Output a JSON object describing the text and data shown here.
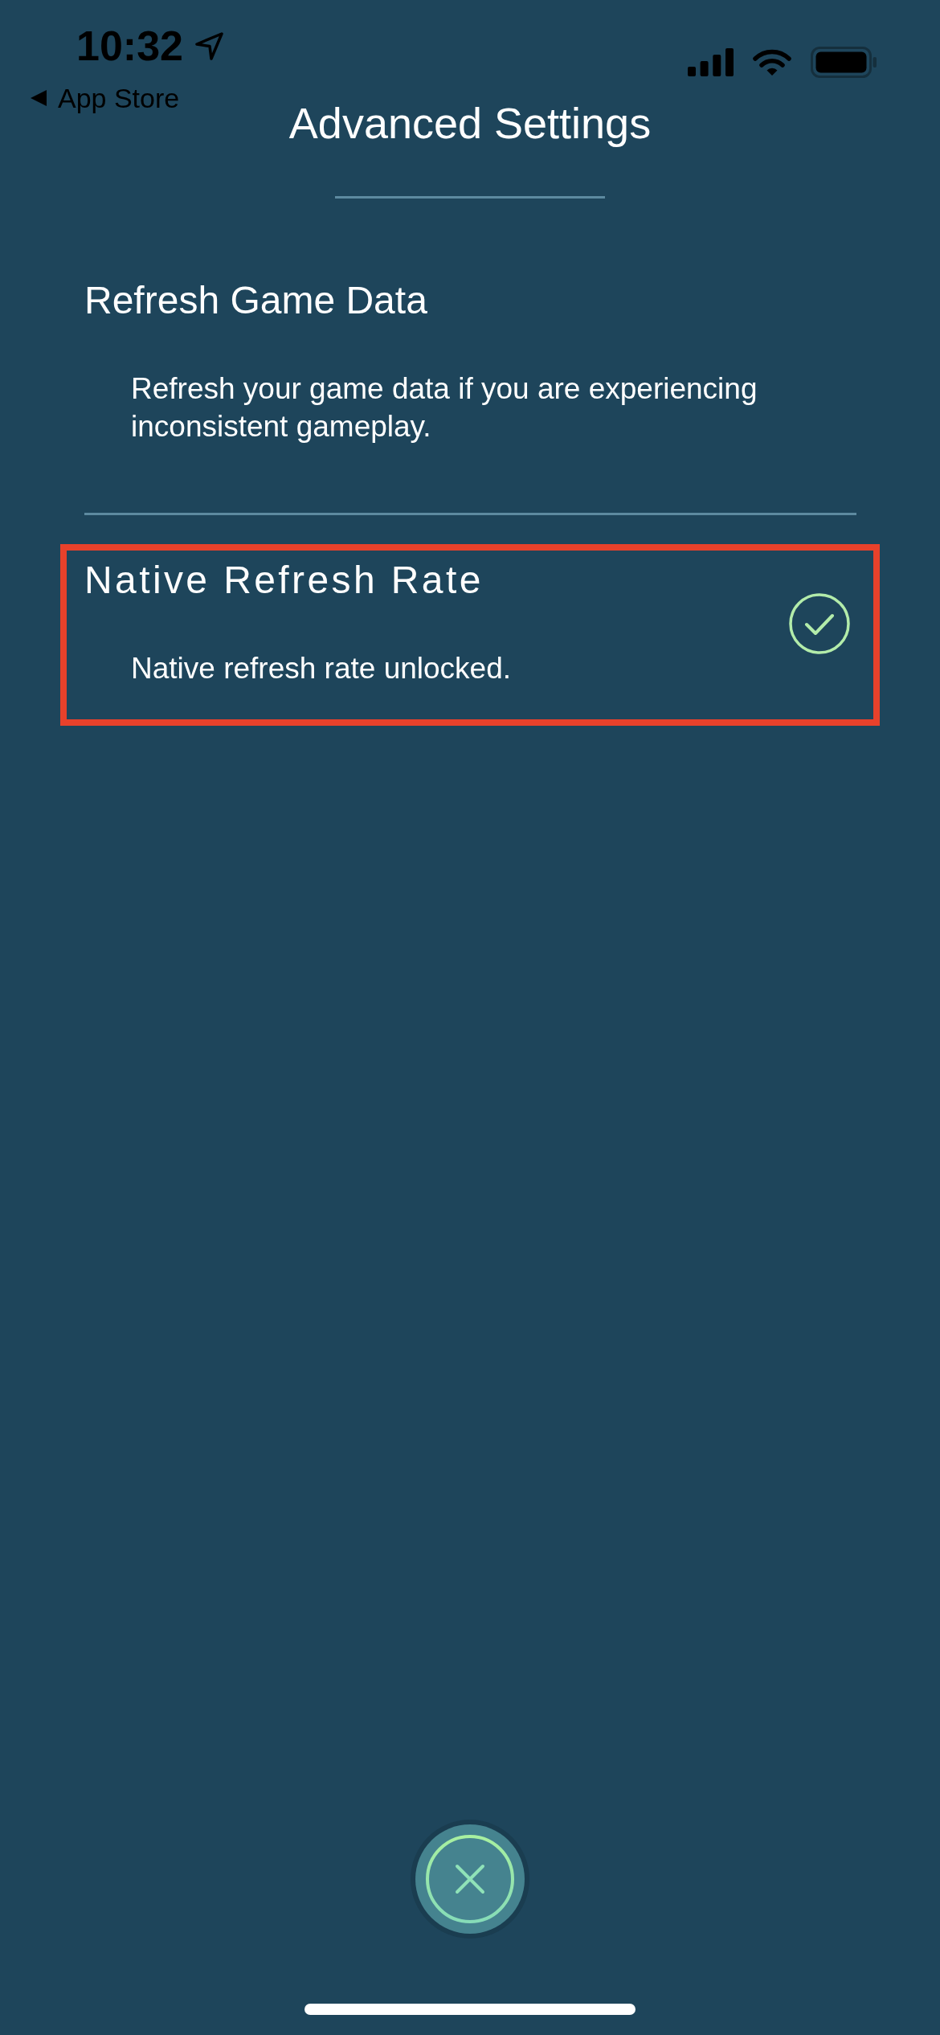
{
  "status_bar": {
    "time": "10:32",
    "back_label": "App Store"
  },
  "header": {
    "title": "Advanced Settings"
  },
  "settings": [
    {
      "title": "Refresh Game Data",
      "description": "Refresh your game data if you are experiencing inconsistent gameplay.",
      "checked": false,
      "highlighted": false
    },
    {
      "title": "Native Refresh Rate",
      "description": "Native refresh rate unlocked.",
      "checked": true,
      "highlighted": true
    }
  ]
}
